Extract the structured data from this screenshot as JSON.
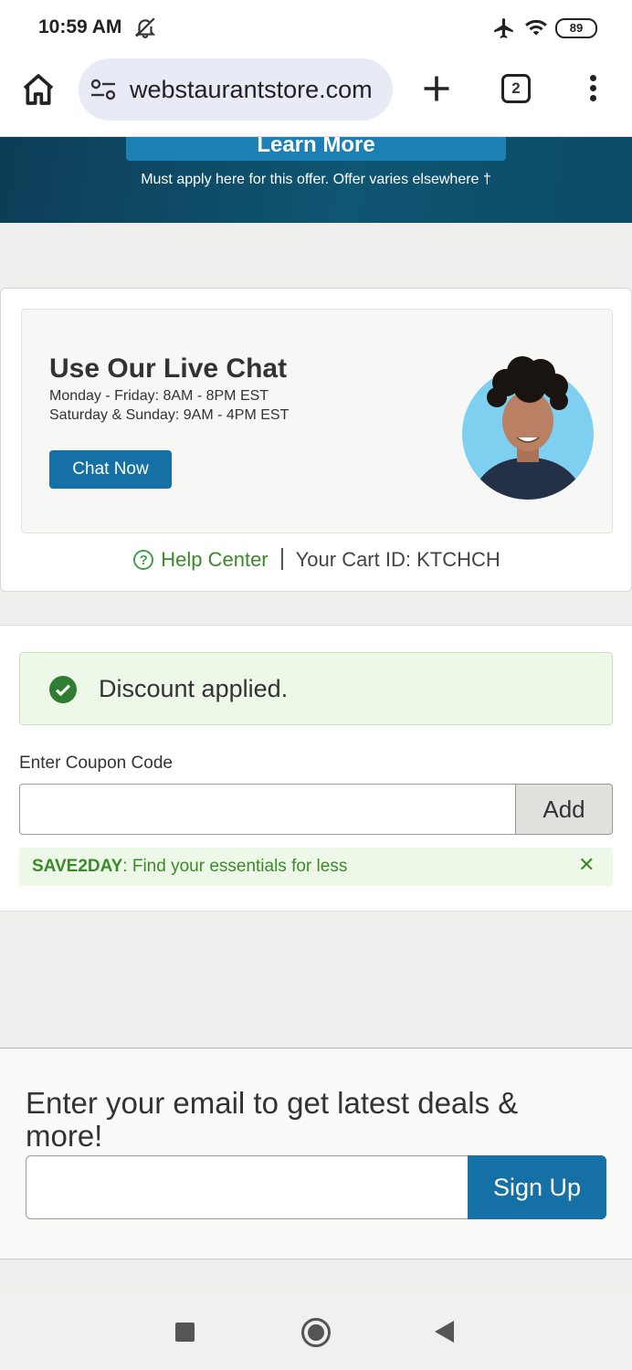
{
  "status_bar": {
    "time": "10:59 AM",
    "battery": "89"
  },
  "browser": {
    "url": "webstaurantstore.com",
    "tab_count": "2"
  },
  "promo": {
    "button_label": "Learn More",
    "note": "Must apply here for this offer. Offer varies elsewhere †"
  },
  "chat": {
    "title": "Use Our Live Chat",
    "hours_weekday": "Monday - Friday: 8AM - 8PM EST",
    "hours_weekend": "Saturday & Sunday: 9AM - 4PM EST",
    "button_label": "Chat Now",
    "help_icon_glyph": "?",
    "help_center_label": "Help Center",
    "cart_id": "Your Cart ID: KTCHCH"
  },
  "coupon": {
    "discount_message": "Discount applied.",
    "label": "Enter Coupon Code",
    "input_value": "",
    "add_label": "Add",
    "promo_code": "SAVE2DAY",
    "promo_text": ": Find your essentials for less",
    "close_glyph": "✕"
  },
  "newsletter": {
    "title": "Enter your email to get latest deals & more!",
    "email_value": "",
    "signup_label": "Sign Up"
  },
  "colors": {
    "primary_blue": "#1570a6",
    "success_green": "#3b8a2a",
    "success_bg": "#edf8e9",
    "promo_dark": "#0d3d57"
  },
  "icons": [
    "bell-off-icon",
    "airplane-icon",
    "wifi-icon",
    "battery-icon",
    "home-icon",
    "site-settings-icon",
    "plus-icon",
    "more-vert-icon",
    "help-circle-icon",
    "check-circle-icon",
    "close-icon",
    "nav-recents-icon",
    "nav-home-icon",
    "nav-back-icon"
  ]
}
